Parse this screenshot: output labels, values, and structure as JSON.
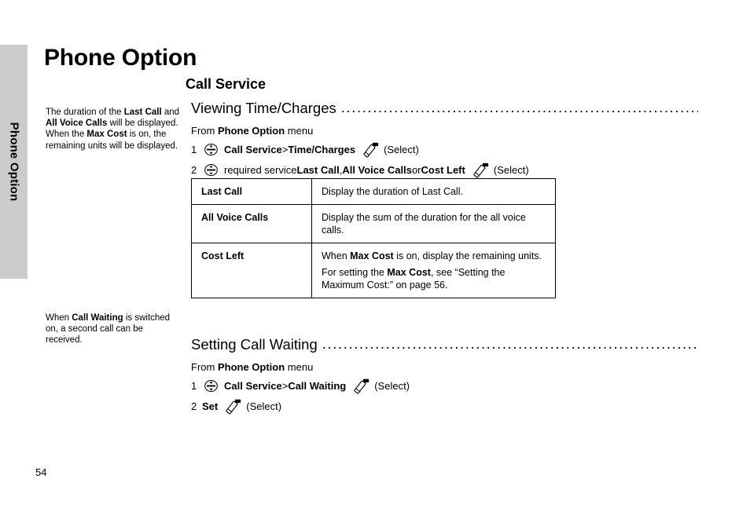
{
  "thumb_tab": {
    "label": "Phone Option",
    "color": "#cccccc"
  },
  "page_title": "Phone Option",
  "chapter_heading": "Call Service",
  "margin_notes": [
    {
      "name": "duration-note",
      "segments": [
        {
          "text": "The duration of the ",
          "bold": false
        },
        {
          "text": "Last Call",
          "bold": true
        },
        {
          "text": " and ",
          "bold": false
        },
        {
          "text": "All Voice Calls",
          "bold": true
        },
        {
          "text": " will be displayed. When the ",
          "bold": false
        },
        {
          "text": "Max Cost",
          "bold": true
        },
        {
          "text": " is on, the remaining units will be displayed.",
          "bold": false
        }
      ]
    },
    {
      "name": "call-waiting-note",
      "segments": [
        {
          "text": "When ",
          "bold": false
        },
        {
          "text": "Call Waiting",
          "bold": true
        },
        {
          "text": " is switched on, a second call can be received.",
          "bold": false
        }
      ]
    }
  ],
  "sections": [
    {
      "heading": "Viewing Time/Charges",
      "leader": "..........................................................................................................",
      "from_line": {
        "prefix": "From ",
        "bold": "Phone Option",
        "suffix": " menu"
      },
      "steps": [
        {
          "number": "1",
          "icon": "nav-key-icon",
          "segments": [
            {
              "text": "Call Service",
              "bold": true
            },
            {
              "text": " > ",
              "bold": false
            },
            {
              "text": "Time/Charges",
              "bold": true
            }
          ],
          "action_icon": "select-softkey-icon",
          "action_label": "(Select)"
        },
        {
          "number": "2",
          "icon": "nav-key-icon",
          "segments": [
            {
              "text": "required service ",
              "bold": false
            },
            {
              "text": "Last Call",
              "bold": true
            },
            {
              "text": ", ",
              "bold": false
            },
            {
              "text": "All Voice Calls",
              "bold": true
            },
            {
              "text": " or ",
              "bold": false
            },
            {
              "text": "Cost Left",
              "bold": true
            }
          ],
          "action_icon": "select-softkey-icon",
          "action_label": "(Select)"
        }
      ]
    },
    {
      "heading": "Setting Call Waiting",
      "leader": "............................................................................................................",
      "from_line": {
        "prefix": "From ",
        "bold": "Phone Option",
        "suffix": " menu"
      },
      "steps": [
        {
          "number": "1",
          "icon": "nav-key-icon",
          "segments": [
            {
              "text": "Call Service",
              "bold": true
            },
            {
              "text": " > ",
              "bold": false
            },
            {
              "text": "Call Waiting",
              "bold": true
            }
          ],
          "action_icon": "select-softkey-icon",
          "action_label": "(Select)"
        },
        {
          "number": "2",
          "icon": null,
          "segments": [
            {
              "text": "Set",
              "bold": true
            }
          ],
          "action_icon": "select-softkey-icon",
          "action_label": "(Select)"
        }
      ]
    }
  ],
  "table": {
    "rows": [
      {
        "term": "Last Call",
        "description": [
          [
            {
              "text": "Display the duration of Last Call.",
              "bold": false
            }
          ]
        ]
      },
      {
        "term": "All Voice Calls",
        "description": [
          [
            {
              "text": "Display the sum of the duration for the all voice calls.",
              "bold": false
            }
          ]
        ]
      },
      {
        "term": "Cost Left",
        "description": [
          [
            {
              "text": "When ",
              "bold": false
            },
            {
              "text": "Max Cost",
              "bold": true
            },
            {
              "text": " is on, display the remaining units.",
              "bold": false
            }
          ],
          [
            {
              "text": "For setting the ",
              "bold": false
            },
            {
              "text": "Max Cost",
              "bold": true
            },
            {
              "text": ", see “Setting the Maximum Cost:” on page 56.",
              "bold": false
            }
          ]
        ]
      }
    ]
  },
  "page_number": "54"
}
